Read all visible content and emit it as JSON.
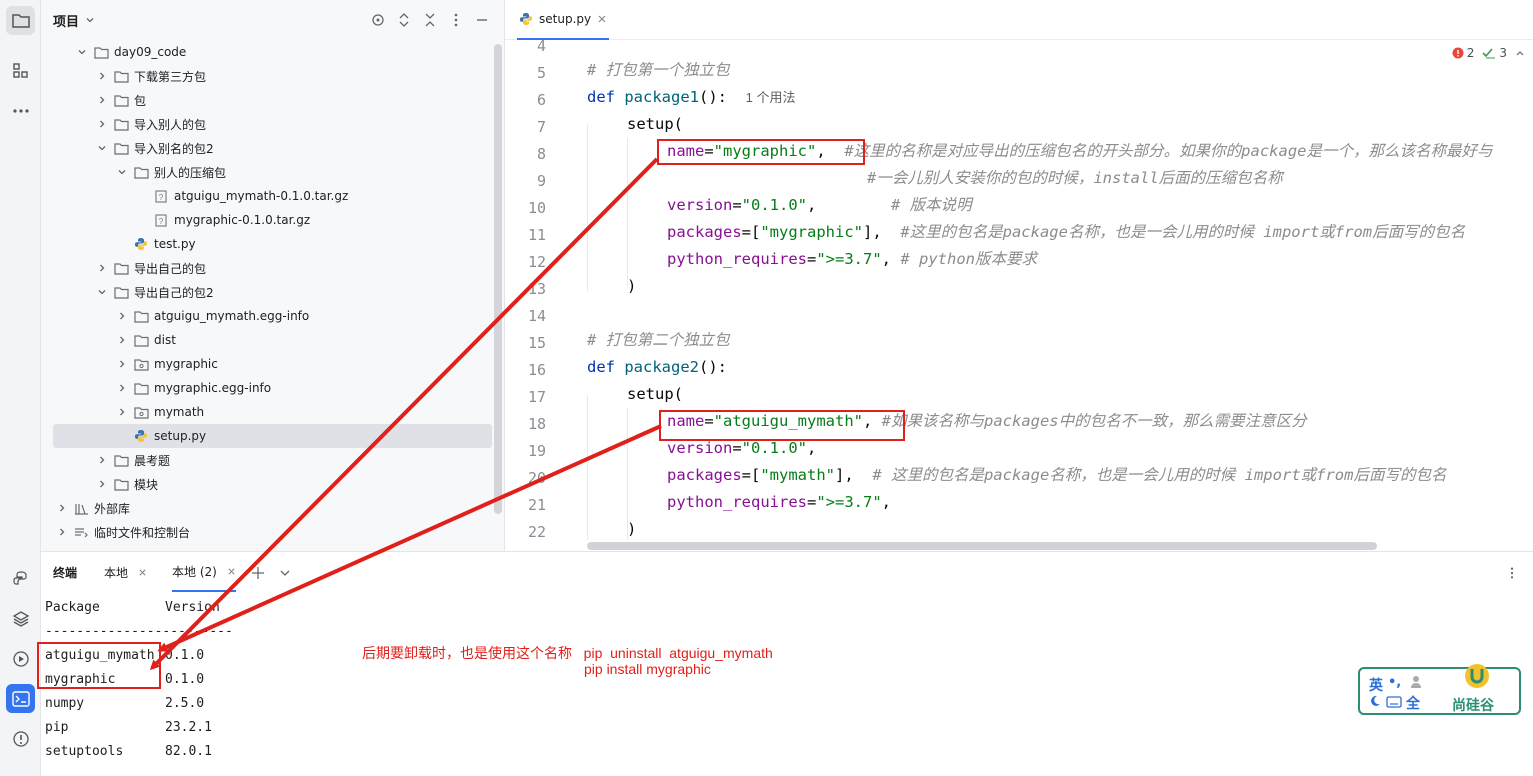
{
  "project": {
    "title": "项目",
    "tree": [
      {
        "label": "day09_code",
        "type": "folder",
        "expanded": true
      },
      {
        "label": "下载第三方包",
        "type": "folder",
        "expanded": false
      },
      {
        "label": "包",
        "type": "folder",
        "expanded": false
      },
      {
        "label": "导入别人的包",
        "type": "folder",
        "expanded": false
      },
      {
        "label": "导入别名的包2",
        "type": "folder",
        "expanded": true
      },
      {
        "label": "别人的压缩包",
        "type": "folder",
        "expanded": true
      },
      {
        "label": "atguigu_mymath-0.1.0.tar.gz",
        "type": "archive"
      },
      {
        "label": "mygraphic-0.1.0.tar.gz",
        "type": "archive"
      },
      {
        "label": "test.py",
        "type": "python"
      },
      {
        "label": "导出自己的包",
        "type": "folder",
        "expanded": false
      },
      {
        "label": "导出自己的包2",
        "type": "folder",
        "expanded": true
      },
      {
        "label": "atguigu_mymath.egg-info",
        "type": "folder",
        "expanded": false
      },
      {
        "label": "dist",
        "type": "folder",
        "expanded": false
      },
      {
        "label": "mygraphic",
        "type": "package",
        "expanded": false
      },
      {
        "label": "mygraphic.egg-info",
        "type": "folder",
        "expanded": false
      },
      {
        "label": "mymath",
        "type": "package",
        "expanded": false
      },
      {
        "label": "setup.py",
        "type": "python",
        "selected": true
      },
      {
        "label": "晨考题",
        "type": "folder",
        "expanded": false
      },
      {
        "label": "模块",
        "type": "folder",
        "expanded": false
      },
      {
        "label": "外部库",
        "type": "library",
        "expanded": false
      },
      {
        "label": "临时文件和控制台",
        "type": "scratch",
        "expanded": false
      }
    ]
  },
  "editor": {
    "tab_label": "setup.py",
    "inspections": {
      "errors": "2",
      "checks": "3"
    },
    "usage_hint": "1 个用法",
    "line_numbers": [
      "4",
      "5",
      "6",
      "7",
      "8",
      "9",
      "10",
      "11",
      "12",
      "13",
      "14",
      "15",
      "16",
      "17",
      "18",
      "19",
      "20",
      "21",
      "22"
    ],
    "code": {
      "l5_comment": "# 打包第一个独立包",
      "l6_def": "def",
      "l6_name": "package1",
      "l6_rest": "():",
      "setup": "setup(",
      "name_kw": "name",
      "l8_val": "\"mygraphic\"",
      "l8_comment": "#这里的名称是对应导出的压缩包名的开头部分。如果你的package是一个，那么该名称最好与",
      "l9_comment": "#一会儿别人安装你的包的时候，install后面的压缩包名称",
      "version_kw": "version",
      "l10_val": "\"0.1.0\"",
      "l10_comment": "# 版本说明",
      "packages_kw": "packages",
      "l11_val": "\"mygraphic\"",
      "l11_comment": "#这里的包名是package名称，也是一会儿用的时候 import或from后面写的包名",
      "python_requires_kw": "python_requires",
      "l12_val": "\">=3.7\"",
      "l12_comment": "# python版本要求",
      "close_paren": ")",
      "l15_comment": "# 打包第二个独立包",
      "l16_name": "package2",
      "l18_val": "\"atguigu_mymath\"",
      "l18_comment": "#如果该名称与packages中的包名不一致，那么需要注意区分",
      "l19_val": "\"0.1.0\"",
      "l20_val": "\"mymath\"",
      "l20_comment": "# 这里的包名是package名称，也是一会儿用的时候 import或from后面写的包名",
      "l21_val": "\">=3.7\""
    }
  },
  "terminal": {
    "title": "终端",
    "tabs": [
      "本地",
      "本地 (2)"
    ],
    "header": [
      "Package",
      "Version"
    ],
    "divider": "------------------------",
    "rows": [
      [
        "atguigu_mymath",
        "0.1.0"
      ],
      [
        "mygraphic",
        "0.1.0"
      ],
      [
        "numpy",
        "2.5.0"
      ],
      [
        "pip",
        "23.2.1"
      ],
      [
        "setuptools",
        "82.0.1"
      ]
    ]
  },
  "annotation": {
    "line1": "后期要卸载时，也是使用这个名称   pip  uninstall  atguigu_mymath",
    "line2": "pip install mygraphic",
    "color": "#e0201b"
  },
  "ime": {
    "mode": "英",
    "punct": "•,",
    "width": "全",
    "brand": "尚硅谷"
  }
}
